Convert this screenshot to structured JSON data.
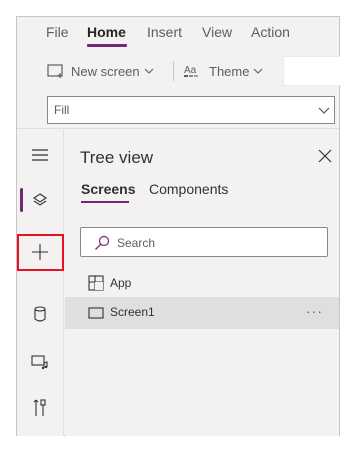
{
  "menu": {
    "items": [
      "File",
      "Home",
      "Insert",
      "View",
      "Action"
    ],
    "active": "Home"
  },
  "toolbar": {
    "new_screen_label": "New screen",
    "theme_label": "Theme"
  },
  "formula_bar": {
    "property": "Fill"
  },
  "rail": {
    "items": [
      "hamburger-menu",
      "tree-view-layers",
      "insert-add",
      "data-cylinder",
      "media",
      "advanced-tools"
    ],
    "active": "tree-view-layers",
    "highlighted": "insert-add"
  },
  "tree_view": {
    "title": "Tree view",
    "tabs": [
      "Screens",
      "Components"
    ],
    "active_tab": "Screens",
    "search_placeholder": "Search",
    "items": [
      {
        "label": "App",
        "icon": "app-icon"
      },
      {
        "label": "Screen1",
        "icon": "screen-icon",
        "selected": true,
        "more": "···"
      }
    ]
  },
  "colors": {
    "accent": "#742774",
    "highlight_border": "#e81123",
    "background": "#f3f2f1",
    "selected_row": "#e1dfdd"
  }
}
